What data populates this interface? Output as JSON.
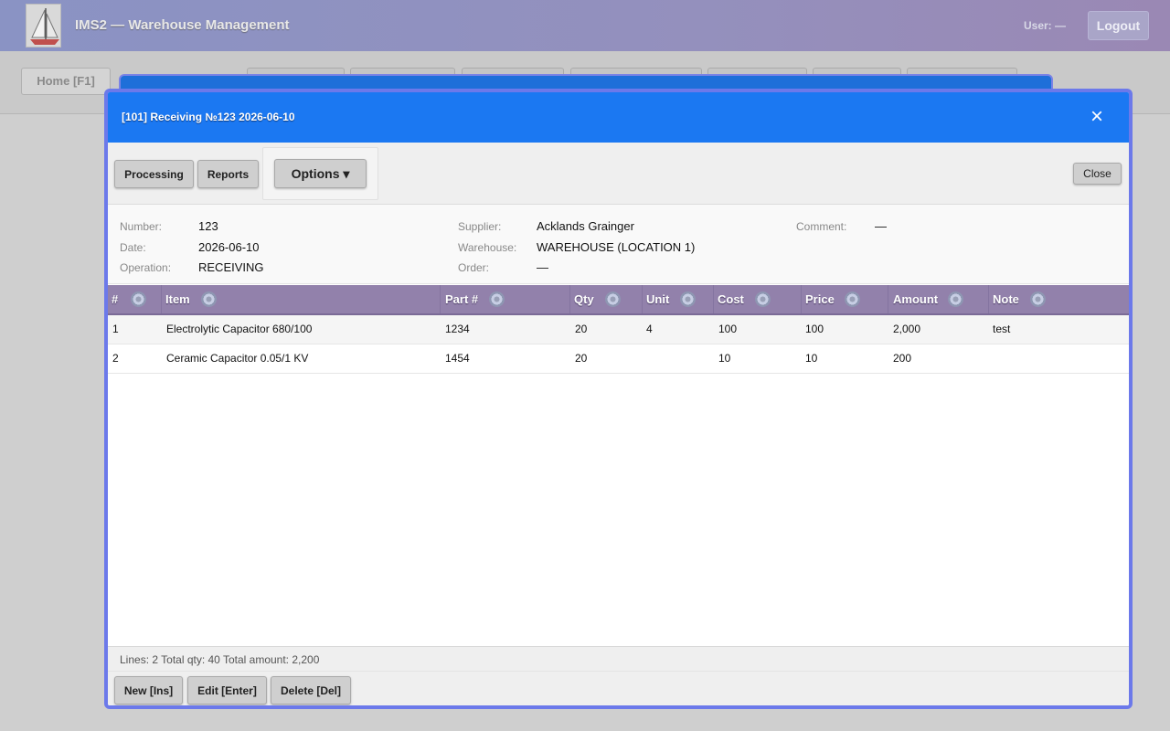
{
  "app": {
    "title": "IMS2 — Warehouse Management",
    "user_label": "User: —",
    "logout_label": "Logout",
    "nav": {
      "home_label": "Home [F1]"
    }
  },
  "dialog": {
    "title": "[101] Receiving №123 2026-06-10",
    "close_icon": "×",
    "toolbar": {
      "processing_label": "Processing",
      "reports_label": "Reports",
      "options_label": "Options ▾",
      "close_label": "Close"
    },
    "info": {
      "number_label": "Number:",
      "number_value": "123",
      "date_label": "Date:",
      "date_value": "2026-06-10",
      "operation_label": "Operation:",
      "operation_value": "RECEIVING",
      "supplier_label": "Supplier:",
      "supplier_value": "Acklands Grainger",
      "warehouse_label": "Warehouse:",
      "warehouse_value": "WAREHOUSE (LOCATION 1)",
      "order_label": "Order:",
      "order_value": "—",
      "comment_label": "Comment:",
      "comment_value": "—"
    },
    "grid": {
      "columns": [
        "#",
        "Item",
        "Part #",
        "Qty",
        "Unit",
        "Cost",
        "Price",
        "Amount",
        "Note"
      ],
      "rows": [
        [
          "1",
          "Electrolytic Capacitor 680/100",
          "1234",
          "20",
          "4",
          "100",
          "100",
          "2,000",
          "test"
        ],
        [
          "2",
          "Ceramic Capacitor 0.05/1 KV",
          "1454",
          "20",
          "",
          "10",
          "10",
          "200",
          ""
        ]
      ]
    },
    "status": "Lines: 2 Total qty: 40 Total amount: 2,200",
    "bottom": {
      "new_label": "New [Ins]",
      "edit_label": "Edit [Enter]",
      "delete_label": "Delete [Del]"
    }
  },
  "colors": {
    "title_bar": "#1b78f2",
    "dialog_border": "#6c79ea",
    "grid_header": "#9281ab",
    "app_header": "#8a93c4"
  }
}
